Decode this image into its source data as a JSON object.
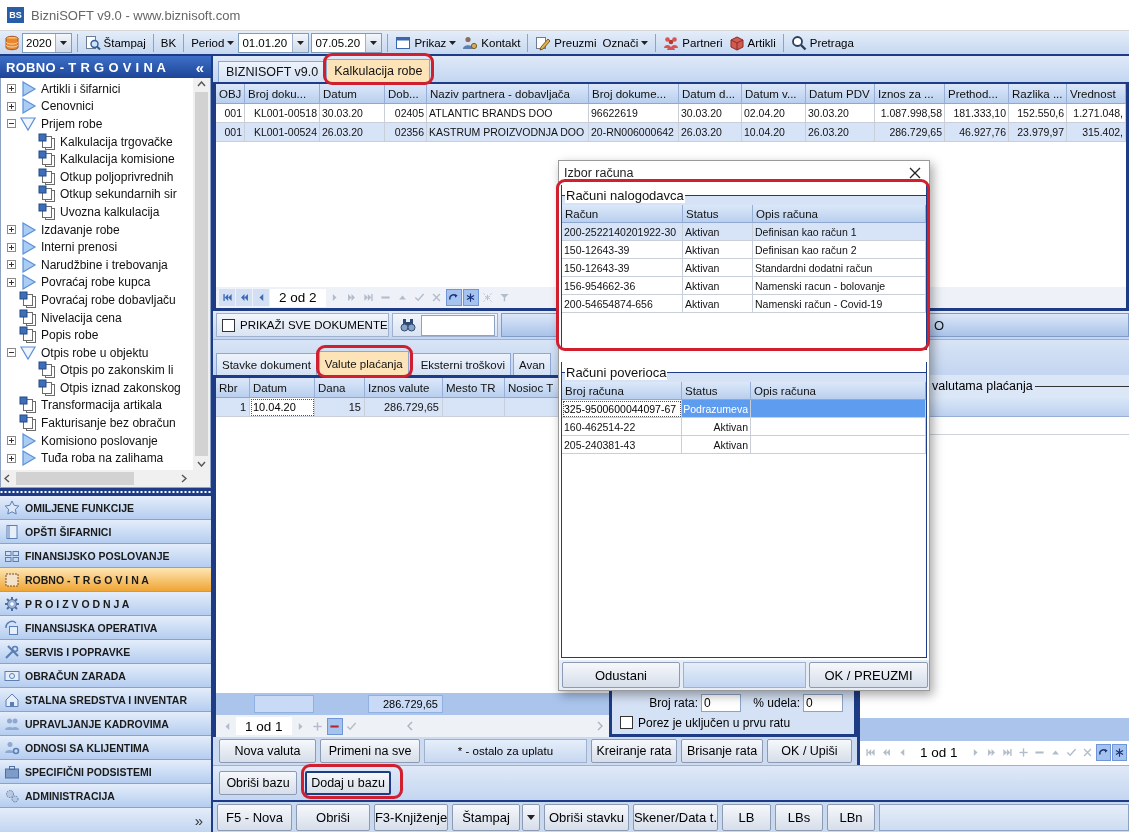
{
  "window": {
    "badge": "BS",
    "title": "BizniSOFT v9.0 - www.biznisoft.com"
  },
  "toolbar": {
    "groups": [
      [
        {
          "kind": "combo",
          "value": "2020"
        }
      ],
      [
        {
          "kind": "button",
          "label": "Štampaj"
        }
      ],
      [
        {
          "kind": "button",
          "label": "BK"
        }
      ],
      [
        {
          "kind": "menu",
          "label": "Period"
        },
        {
          "kind": "combo",
          "value": "01.01.20"
        },
        {
          "kind": "combo",
          "value": "07.05.20"
        }
      ],
      [
        {
          "kind": "menu",
          "label": "Prikaz"
        },
        {
          "kind": "button",
          "label": "Kontakt"
        }
      ],
      [
        {
          "kind": "button",
          "label": "Preuzmi"
        },
        {
          "kind": "menu",
          "label": "Označi"
        }
      ],
      [
        {
          "kind": "button",
          "label": "Partneri"
        },
        {
          "kind": "button",
          "label": "Artikli"
        }
      ],
      [
        {
          "kind": "button",
          "label": "Pretraga"
        }
      ]
    ]
  },
  "sidebar": {
    "title": "ROBNO - T R G O V I N A",
    "collapse": "«",
    "tree": [
      {
        "kind": "folder",
        "label": "Artikli i šifarnici",
        "expanded": false
      },
      {
        "kind": "folder",
        "label": "Cenovnici",
        "expanded": false
      },
      {
        "kind": "folder",
        "label": "Prijem robe",
        "expanded": true,
        "children": [
          {
            "kind": "document",
            "label": "Kalkulacija trgovačke"
          },
          {
            "kind": "document",
            "label": "Kalkulacija komisione"
          },
          {
            "kind": "document",
            "label": "Otkup poljoprivrednih"
          },
          {
            "kind": "document",
            "label": "Otkup sekundarnih sir"
          },
          {
            "kind": "document",
            "label": "Uvozna kalkulacija"
          }
        ]
      },
      {
        "kind": "folder",
        "label": "Izdavanje robe",
        "expanded": false
      },
      {
        "kind": "folder",
        "label": "Interni prenosi",
        "expanded": false
      },
      {
        "kind": "folder",
        "label": "Narudžbine i trebovanja",
        "expanded": false
      },
      {
        "kind": "folder",
        "label": "Povraćaj robe kupca",
        "expanded": false
      },
      {
        "kind": "document",
        "label": "Povraćaj robe dobavljaču"
      },
      {
        "kind": "document",
        "label": "Nivelacija cena"
      },
      {
        "kind": "document",
        "label": "Popis robe"
      },
      {
        "kind": "folder",
        "label": "Otpis robe u objektu",
        "expanded": true,
        "children": [
          {
            "kind": "document",
            "label": "Otpis po zakonskim li"
          },
          {
            "kind": "document",
            "label": "Otpis iznad zakonskog"
          }
        ]
      },
      {
        "kind": "document",
        "label": "Transformacija artikala"
      },
      {
        "kind": "document",
        "label": "Fakturisanje bez obračun"
      },
      {
        "kind": "folder",
        "label": "Komisiono poslovanje",
        "expanded": false
      },
      {
        "kind": "folder",
        "label": "Tuđa roba na zalihama",
        "expanded": false
      }
    ],
    "modules": [
      {
        "label": "OMILJENE FUNKCIJE",
        "selected": false
      },
      {
        "label": "OPŠTI ŠIFARNICI",
        "selected": false
      },
      {
        "label": "FINANSIJSKO POSLOVANJE",
        "selected": false
      },
      {
        "label": "ROBNO - T R G O V I N A",
        "selected": true
      },
      {
        "label": "P R O I Z V O D N J A",
        "selected": false
      },
      {
        "label": "FINANSIJSKA OPERATIVA",
        "selected": false
      },
      {
        "label": "SERVIS I POPRAVKE",
        "selected": false
      },
      {
        "label": "OBRAČUN ZARADA",
        "selected": false
      },
      {
        "label": "STALNA SREDSTVA I INVENTAR",
        "selected": false
      },
      {
        "label": "UPRAVLJANJE KADROVIMA",
        "selected": false
      },
      {
        "label": "ODNOSI SA KLIJENTIMA",
        "selected": false
      },
      {
        "label": "SPECIFIČNI PODSISTEMI",
        "selected": false
      },
      {
        "label": "ADMINISTRACIJA",
        "selected": false
      }
    ],
    "more": "»"
  },
  "doc_tabs": [
    {
      "label": "BIZNISOFT v9.0",
      "selected": false,
      "highlighted": false
    },
    {
      "label": "Kalkulacija robe",
      "selected": true,
      "highlighted": true
    }
  ],
  "documents": {
    "columns": [
      "OBJ",
      "Broj doku...",
      "Datum",
      "Dob...",
      "Naziv partnera - dobavljača",
      "Broj dokume...",
      "Datum d...",
      "Datum v...",
      "Datum PDV",
      "Iznos za ...",
      "Prethod...",
      "Razlika ...",
      "Vrednost"
    ],
    "rows": [
      {
        "cells": [
          "001",
          "KL001-00518",
          "30.03.20",
          "02405",
          "ATLANTIC BRANDS DOO",
          "96622619",
          "30.03.20",
          "02.04.20",
          "30.03.20",
          "1.087.998,58",
          "181.333,10",
          "152.550,6",
          "1.271.048,"
        ],
        "selected": false
      },
      {
        "cells": [
          "001",
          "KL001-00524",
          "26.03.20",
          "02356",
          "KASTRUM PROIZVODNJA DOO",
          "20-RN006000642",
          "26.03.20",
          "10.04.20",
          "26.03.20",
          "286.729,65",
          "46.927,76",
          "23.979,97",
          "315.402,"
        ],
        "selected": true
      }
    ],
    "pager": {
      "position": "2 od 2",
      "buttons": [
        {
          "kind": "first",
          "disabled": false,
          "active": false
        },
        {
          "kind": "prev-page",
          "disabled": false,
          "active": false
        },
        {
          "kind": "prev",
          "disabled": false,
          "active": false
        },
        {
          "kind": "next",
          "disabled": true,
          "active": false
        },
        {
          "kind": "next-page",
          "disabled": true,
          "active": false
        },
        {
          "kind": "last",
          "disabled": true,
          "active": false
        },
        {
          "kind": "minus",
          "disabled": true,
          "active": false
        },
        {
          "kind": "up",
          "disabled": true,
          "active": false
        },
        {
          "kind": "check",
          "disabled": true,
          "active": false
        },
        {
          "kind": "cross",
          "disabled": true,
          "active": false
        },
        {
          "kind": "refresh",
          "disabled": false,
          "active": true
        },
        {
          "kind": "asterisk",
          "disabled": false,
          "active": true
        },
        {
          "kind": "sparkle",
          "disabled": true,
          "active": false
        },
        {
          "kind": "filter",
          "disabled": true,
          "active": false
        }
      ]
    }
  },
  "filter_bar": {
    "show_all": {
      "label": "PRIKAŽI SVE DOKUMENTE",
      "checked": false
    },
    "button_behind_dialog": "O"
  },
  "detail_tabs": [
    {
      "label": "Stavke dokument",
      "selected": false,
      "highlighted": false
    },
    {
      "label": "Valute plaćanja",
      "selected": true,
      "highlighted": true
    },
    {
      "label": "Eksterni troškovi",
      "selected": false,
      "highlighted": false
    },
    {
      "label": "Avan",
      "selected": false,
      "highlighted": false
    }
  ],
  "payments": {
    "columns": [
      "Rbr",
      "Datum",
      "Dana",
      "Iznos valute",
      "Mesto TR",
      "Nosioc T"
    ],
    "rows": [
      {
        "cells": [
          "1",
          "10.04.20",
          "15",
          "286.729,65"
        ],
        "selected": true,
        "focused": [
          false,
          true,
          false,
          false
        ]
      }
    ],
    "total": "286.729,65",
    "pager": {
      "position": "1 od 1",
      "buttons": [
        {
          "kind": "prev",
          "disabled": true,
          "active": false
        },
        {
          "kind": "next",
          "disabled": true,
          "active": false
        },
        {
          "kind": "plus",
          "disabled": true,
          "active": false
        },
        {
          "kind": "minus",
          "disabled": false,
          "active": true
        },
        {
          "kind": "check",
          "disabled": true,
          "active": false
        }
      ]
    }
  },
  "payment_actions": {
    "buttons": [
      "Nova valuta",
      "Primeni na sve"
    ],
    "note": "* - ostalo za uplatu",
    "installment_buttons": [
      "Kreiranje rata",
      "Brisanje rata",
      "OK / Upiši"
    ]
  },
  "installments": {
    "count_label": "Broj rata:",
    "count": "0",
    "share_label": "% udela:",
    "share": "0",
    "tax_in_first": {
      "label": "Porez je uključen u prvu ratu",
      "checked": false
    }
  },
  "currency_summary": {
    "title": "valutama plaćanja",
    "pager": {
      "position": "1 od 1",
      "buttons": [
        {
          "kind": "first",
          "disabled": true,
          "active": false
        },
        {
          "kind": "prev-page",
          "disabled": true,
          "active": false
        },
        {
          "kind": "prev",
          "disabled": true,
          "active": false
        },
        {
          "kind": "next",
          "disabled": true,
          "active": false
        },
        {
          "kind": "next-page",
          "disabled": true,
          "active": false
        },
        {
          "kind": "last",
          "disabled": true,
          "active": false
        },
        {
          "kind": "plus",
          "disabled": true,
          "active": false
        },
        {
          "kind": "minus",
          "disabled": true,
          "active": false
        },
        {
          "kind": "up",
          "disabled": true,
          "active": false
        },
        {
          "kind": "check",
          "disabled": true,
          "active": false
        },
        {
          "kind": "cross",
          "disabled": true,
          "active": false
        },
        {
          "kind": "refresh",
          "disabled": false,
          "active": true
        },
        {
          "kind": "asterisk",
          "disabled": false,
          "active": true
        }
      ]
    }
  },
  "base_buttons": [
    {
      "label": "Obriši bazu",
      "highlighted": false,
      "focused": false
    },
    {
      "label": "Dodaj u bazu",
      "highlighted": true,
      "focused": true
    }
  ],
  "footer_buttons": [
    {
      "label": "F5 - Nova",
      "dropdown": false
    },
    {
      "label": "Obriši",
      "dropdown": false
    },
    {
      "label": "F3-Knjiženje",
      "dropdown": false
    },
    {
      "label": "Štampaj",
      "dropdown": true
    },
    {
      "label": "Obriši stavku",
      "dropdown": false
    },
    {
      "label": "Skener/Data t.",
      "dropdown": false
    },
    {
      "label": "LB",
      "dropdown": false
    },
    {
      "label": "LBs",
      "dropdown": false
    },
    {
      "label": "LBn",
      "dropdown": false
    }
  ],
  "dialog": {
    "title": "Izbor računa",
    "groups": [
      {
        "title": "Računi nalogodavca",
        "highlighted": true,
        "columns": [
          "Račun",
          "Status",
          "Opis računa"
        ],
        "rows": [
          {
            "cells": [
              "200-2522140201922-30",
              "Aktivan",
              "Definisan kao račun 1"
            ],
            "selected": true
          },
          {
            "cells": [
              "150-12643-39",
              "Aktivan",
              "Definisan kao račun 2"
            ],
            "selected": false
          },
          {
            "cells": [
              "150-12643-39",
              "Aktivan",
              "Standardni dodatni račun"
            ],
            "selected": false
          },
          {
            "cells": [
              "156-954662-36",
              "Aktivan",
              "Namenski racun - bolovanje"
            ],
            "selected": false
          },
          {
            "cells": [
              "200-54654874-656",
              "Aktivan",
              "Namenski račun - Covid-19"
            ],
            "selected": false
          }
        ]
      },
      {
        "title": "Računi poverioca",
        "highlighted": false,
        "columns": [
          "Broj računa",
          "Status",
          "Opis računa"
        ],
        "rows": [
          {
            "cells": [
              "325-9500600044097-67",
              "Podrazumeva"
            ],
            "selected": true,
            "focused": [
              true,
              false
            ]
          },
          {
            "cells": [
              "160-462514-22",
              "Aktivan"
            ],
            "selected": false
          },
          {
            "cells": [
              "205-240381-43",
              "Aktivan"
            ],
            "selected": false
          }
        ]
      }
    ],
    "buttons": [
      "Odustani",
      "OK / PREUZMI"
    ]
  }
}
